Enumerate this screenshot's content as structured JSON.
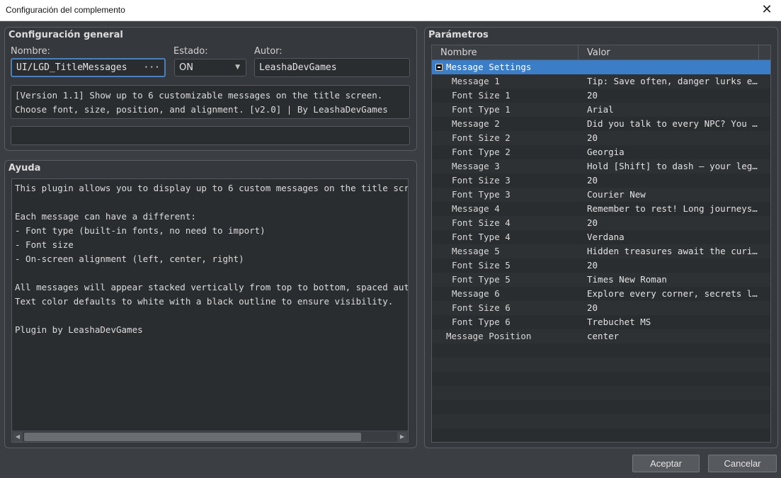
{
  "window": {
    "title": "Configuración del complemento"
  },
  "general": {
    "title": "Configuración general",
    "name_label": "Nombre:",
    "name_value": "UI/LGD_TitleMessages",
    "name_button": "···",
    "status_label": "Estado:",
    "status_value": "ON",
    "author_label": "Autor:",
    "author_value": "LeashaDevGames",
    "description": "[Version 1.1] Show up to 6 customizable messages on the title screen. Choose font, size, position, and alignment. [v2.0] | By LeashaDevGames",
    "extra": ""
  },
  "help": {
    "title": "Ayuda",
    "text": "This plugin allows you to display up to 6 custom messages on the title screen.\n\nEach message can have a different:\n- Font type (built-in fonts, no need to import)\n- Font size\n- On-screen alignment (left, center, right)\n\nAll messages will appear stacked vertically from top to bottom, spaced automati\nText color defaults to white with a black outline to ensure visibility.\n\nPlugin by LeashaDevGames",
    "scroll_left": "◀",
    "scroll_right": "▶"
  },
  "params": {
    "title": "Parámetros",
    "col_name": "Nombre",
    "col_value": "Valor",
    "group": "Message Settings",
    "rows": [
      {
        "name": "Message 1",
        "value": "Tip: Save often, danger lurks ev…"
      },
      {
        "name": "Font Size 1",
        "value": "20"
      },
      {
        "name": "Font Type 1",
        "value": "Arial"
      },
      {
        "name": "Message 2",
        "value": "Did you talk to every NPC? You m…"
      },
      {
        "name": "Font Size 2",
        "value": "20"
      },
      {
        "name": "Font Type 2",
        "value": "Georgia"
      },
      {
        "name": "Message 3",
        "value": "Hold [Shift] to dash — your legs…"
      },
      {
        "name": "Font Size 3",
        "value": "20"
      },
      {
        "name": "Font Type 3",
        "value": "Courier New"
      },
      {
        "name": "Message 4",
        "value": "Remember to rest! Long journeys …"
      },
      {
        "name": "Font Size 4",
        "value": "20"
      },
      {
        "name": "Font Type 4",
        "value": "Verdana"
      },
      {
        "name": "Message 5",
        "value": "Hidden treasures await the curio…"
      },
      {
        "name": "Font Size 5",
        "value": "20"
      },
      {
        "name": "Font Type 5",
        "value": "Times New Roman"
      },
      {
        "name": "Message 6",
        "value": "Explore every corner, secrets li…"
      },
      {
        "name": "Font Size 6",
        "value": "20"
      },
      {
        "name": "Font Type 6",
        "value": "Trebuchet MS"
      }
    ],
    "position_name": "Message Position",
    "position_value": "center"
  },
  "buttons": {
    "ok": "Aceptar",
    "cancel": "Cancelar"
  }
}
